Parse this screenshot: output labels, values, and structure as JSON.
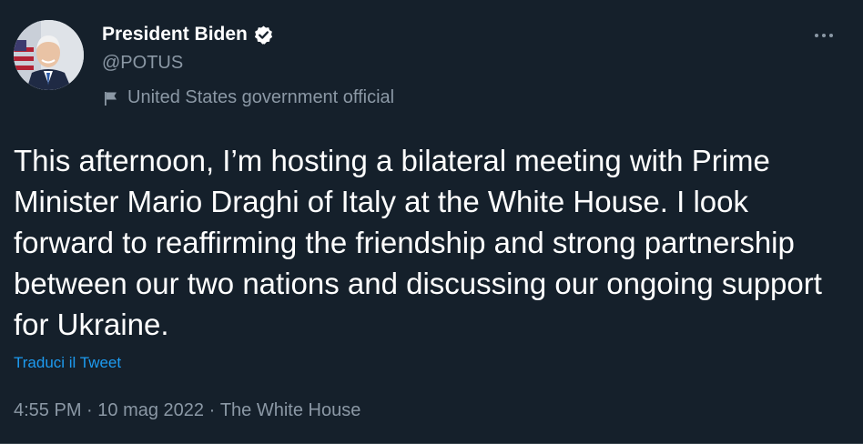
{
  "author": {
    "display_name": "President Biden",
    "handle": "@POTUS",
    "label": "United States government official",
    "verified": true
  },
  "tweet": {
    "text": "This afternoon, I’m hosting a bilateral meeting with Prime Minister Mario Draghi of Italy at the White House. I look forward to reaffirming the friendship and strong partnership between our two nations and discussing our ongoing support for Ukraine.",
    "translate_label": "Traduci il Tweet",
    "time": "4:55 PM",
    "date": "10 mag 2022",
    "source": "The White House",
    "separator": " · "
  },
  "icons": {
    "verified": "verified-badge-icon",
    "label": "flag-icon",
    "more": "more-options-icon"
  },
  "colors": {
    "background": "#15202b",
    "secondary_text": "#8b98a5",
    "link": "#1d9bf0"
  }
}
